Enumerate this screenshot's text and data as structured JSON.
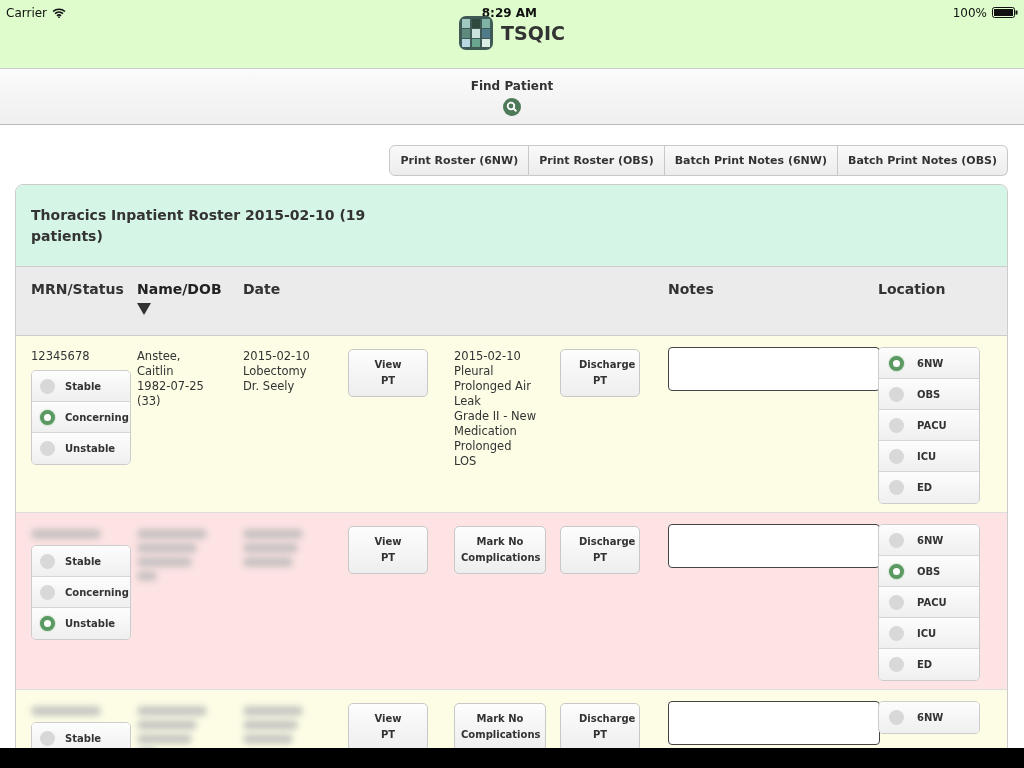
{
  "status_bar": {
    "carrier": "Carrier",
    "time": "8:29 AM",
    "battery": "100%"
  },
  "app": {
    "title": "TSQIC"
  },
  "nav": {
    "label": "Find Patient"
  },
  "print_buttons": [
    "Print Roster (6NW)",
    "Print Roster (OBS)",
    "Batch Print Notes (6NW)",
    "Batch Print Notes (OBS)"
  ],
  "roster": {
    "title": "Thoracics Inpatient Roster 2015-02-10 (19 patients)",
    "columns": [
      {
        "label": "MRN/Status",
        "sorted": false
      },
      {
        "label": "Name/DOB",
        "sorted": true
      },
      {
        "label": "Date",
        "sorted": false
      },
      {
        "label": "Notes",
        "sorted": false
      },
      {
        "label": "Location",
        "sorted": false
      }
    ],
    "rows": [
      {
        "color": "#fdfde6",
        "redacted": false,
        "mrn": "12345678",
        "name_dob": [
          "Anstee,",
          "Caitlin",
          "1982-07-25",
          "(33)"
        ],
        "date": [
          "2015-02-10",
          "Lobectomy",
          "Dr. Seely"
        ],
        "statuses": [
          {
            "label": "Stable",
            "selected": false
          },
          {
            "label": "Concerning",
            "selected": true
          },
          {
            "label": "Unstable",
            "selected": false
          }
        ],
        "view_button": "View PT",
        "middle": {
          "kind": "complications",
          "lines": [
            "2015-02-10",
            "Pleural",
            "Prolonged Air",
            "Leak",
            "Grade II - New",
            "Medication",
            "Prolonged",
            "LOS"
          ]
        },
        "discharge_button": "Discharge PT",
        "locations": [
          {
            "label": "6NW",
            "selected": true
          },
          {
            "label": "OBS",
            "selected": false
          },
          {
            "label": "PACU",
            "selected": false
          },
          {
            "label": "ICU",
            "selected": false
          },
          {
            "label": "ED",
            "selected": false
          }
        ]
      },
      {
        "color": "#fde3e3",
        "redacted": true,
        "statuses": [
          {
            "label": "Stable",
            "selected": false
          },
          {
            "label": "Concerning",
            "selected": false
          },
          {
            "label": "Unstable",
            "selected": true
          }
        ],
        "view_button": "View PT",
        "middle": {
          "kind": "button",
          "label": "Mark No Complications"
        },
        "discharge_button": "Discharge PT",
        "locations": [
          {
            "label": "6NW",
            "selected": false
          },
          {
            "label": "OBS",
            "selected": true
          },
          {
            "label": "PACU",
            "selected": false
          },
          {
            "label": "ICU",
            "selected": false
          },
          {
            "label": "ED",
            "selected": false
          }
        ]
      },
      {
        "color": "#fdfde6",
        "redacted": true,
        "statuses": [
          {
            "label": "Stable",
            "selected": false
          }
        ],
        "view_button": "View PT",
        "middle": {
          "kind": "button",
          "label": "Mark No Complications"
        },
        "discharge_button": "Discharge PT",
        "locations": [
          {
            "label": "6NW",
            "selected": false
          }
        ]
      }
    ]
  }
}
